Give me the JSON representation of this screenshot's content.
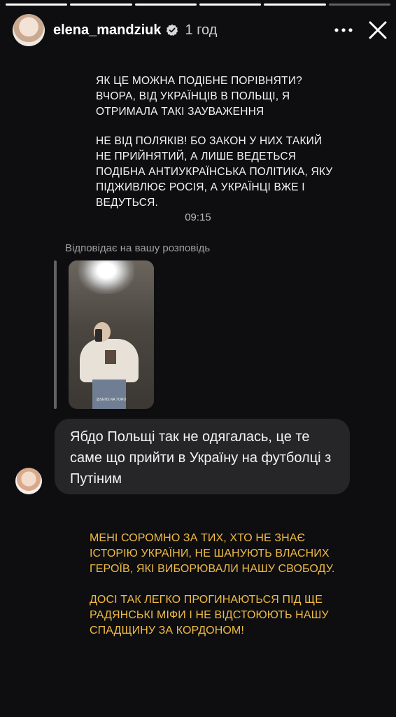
{
  "story": {
    "progress": {
      "total": 6,
      "completed": 5
    },
    "header": {
      "username": "elena_mandziuk",
      "verified": true,
      "time": "1 год",
      "icons": [
        "more-icon",
        "close-icon"
      ]
    },
    "message_top": {
      "paragraphs": [
        "ЯК ЦЕ МОЖНА ПОДІБНЕ ПОРІВНЯТИ?\nВЧОРА, ВІД УКРАЇНЦІВ В ПОЛЬЩІ, Я\nОТРИМАЛА ТАКІ ЗАУВАЖЕННЯ",
        "НЕ ВІД ПОЛЯКІВ! БО ЗАКОН У НИХ ТАКИЙ\nНЕ ПРИЙНЯТИЙ, А ЛИШЕ ВЕДЕТЬСЯ\nПОДІБНА АНТИУКРАЇНСЬКА ПОЛІТИКА, ЯКУ\nПІДЖИВЛЮЄ РОСІЯ, А УКРАЇНЦІ ВЖЕ І\nВЕДУТЬСЯ."
      ]
    },
    "timestamp": "09:15",
    "reply_label": "Відповідає на вашу розповідь",
    "thumbnail": {
      "watermark": "@SENS.NA.TORO"
    },
    "reply_message": "Ябдо Польщі так не одягалась, це те саме що прийти в Україну на футболці з Путіним",
    "message_bottom": {
      "color": "#f0bb45",
      "paragraphs": [
        "МЕНІ СОРОМНО ЗА ТИХ, ХТО НЕ ЗНАЄ\nІСТОРІЮ УКРАЇНИ, НЕ ШАНУЮТЬ ВЛАСНИХ\nГЕРОЇВ, ЯКІ ВИБОРЮВАЛИ НАШУ СВОБОДУ.",
        "ДОСІ ТАК ЛЕГКО ПРОГИНАЮТЬСЯ ПІД ЩЕ\nРАДЯНСЬКІ МІФИ І НЕ ВІДСТОЮЮТЬ НАШУ\nСПАДЩИНУ ЗА КОРДОНОМ!"
      ]
    }
  }
}
